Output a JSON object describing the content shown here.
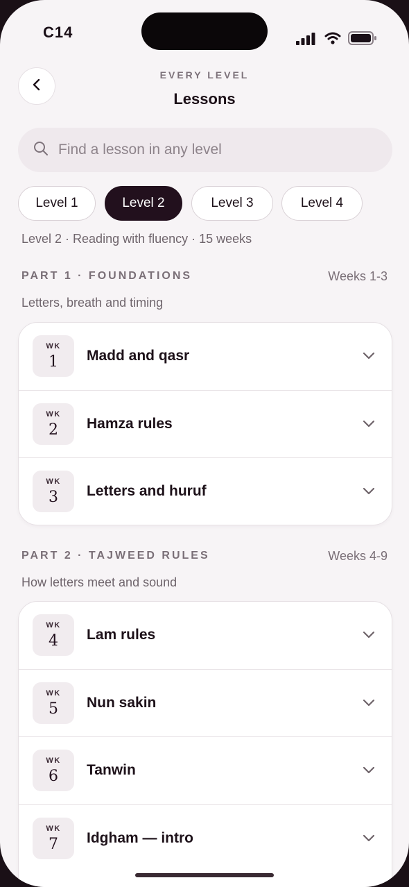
{
  "status_bar": {
    "time": "C14"
  },
  "header": {
    "eyebrow": "EVERY LEVEL",
    "title": "Lessons"
  },
  "search": {
    "placeholder": "Find a lesson in any level"
  },
  "levels": [
    {
      "label": "Level 1",
      "selected": false
    },
    {
      "label": "Level 2",
      "selected": true
    },
    {
      "label": "Level 3",
      "selected": false
    },
    {
      "label": "Level 4",
      "selected": false
    }
  ],
  "level_description": "Level 2 · Reading with fluency · 15 weeks",
  "sections": [
    {
      "title": "PART 1 · FOUNDATIONS",
      "weeks": "Weeks 1-3",
      "subtitle": "Letters, breath and timing",
      "lessons": [
        {
          "wk": "WK",
          "number": "1",
          "title": "Madd and qasr"
        },
        {
          "wk": "WK",
          "number": "2",
          "title": "Hamza rules"
        },
        {
          "wk": "WK",
          "number": "3",
          "title": "Letters and huruf"
        }
      ]
    },
    {
      "title": "PART 2 · TAJWEED RULES",
      "weeks": "Weeks 4-9",
      "subtitle": "How letters meet and sound",
      "lessons": [
        {
          "wk": "WK",
          "number": "4",
          "title": "Lam rules"
        },
        {
          "wk": "WK",
          "number": "5",
          "title": "Nun sakin"
        },
        {
          "wk": "WK",
          "number": "6",
          "title": "Tanwin"
        },
        {
          "wk": "WK",
          "number": "7",
          "title": "Idgham — intro"
        }
      ]
    }
  ],
  "colors": {
    "accent": "#22101d",
    "background": "#f7f4f6",
    "muted": "#7a6f77"
  }
}
